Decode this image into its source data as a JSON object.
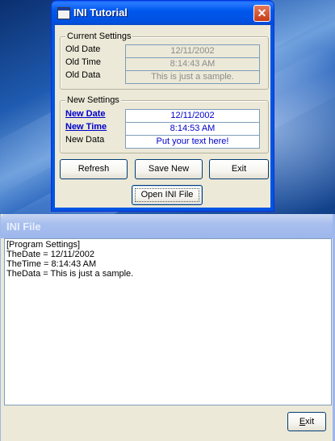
{
  "main_window": {
    "title": "INI Tutorial",
    "close_glyph": "✕",
    "current_settings": {
      "legend": "Current Settings",
      "rows": [
        {
          "label": "Old Date",
          "value": "12/11/2002"
        },
        {
          "label": "Old Time",
          "value": "8:14:43 AM"
        },
        {
          "label": "Old Data",
          "value": "This is just a sample."
        }
      ]
    },
    "new_settings": {
      "legend": "New Settings",
      "rows": [
        {
          "label": "New Date",
          "value": "12/11/2002"
        },
        {
          "label": "New Time",
          "value": "8:14:53 AM"
        },
        {
          "label": "New Data",
          "value": "Put your text here!"
        }
      ]
    },
    "buttons": {
      "refresh": "Refresh",
      "save_new": "Save New",
      "exit": "Exit",
      "open_ini": "Open INI File"
    }
  },
  "ini_window": {
    "title": "INI File",
    "lines": [
      "[Program Settings]",
      "TheDate = 12/11/2002",
      "TheTime = 8:14:43 AM",
      "TheData = This is just a sample."
    ],
    "exit_button": {
      "mnemonic": "E",
      "rest": "xit"
    }
  },
  "colors": {
    "title_active": "#0054e3",
    "title_inactive": "#9db6ec",
    "dialog_face": "#ece9d8",
    "link_blue": "#0000cc",
    "disabled_text": "#8b8b8b"
  }
}
